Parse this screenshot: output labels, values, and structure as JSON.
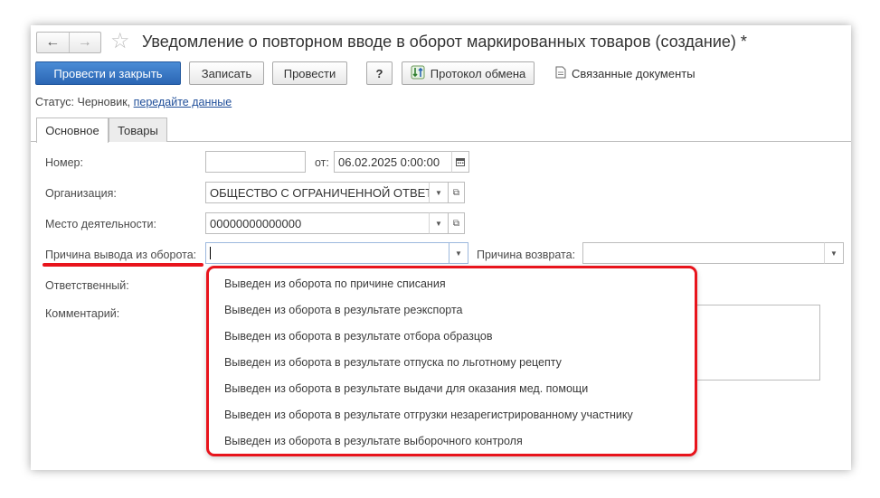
{
  "header": {
    "back_icon": "←",
    "forward_icon": "→",
    "star_icon": "☆",
    "title": "Уведомление о повторном вводе в оборот маркированных товаров (создание) *"
  },
  "toolbar": {
    "post_close_label": "Провести и закрыть",
    "save_label": "Записать",
    "post_label": "Провести",
    "help_label": "?",
    "protocol_label": "Протокол обмена",
    "related_docs_label": "Связанные документы"
  },
  "status": {
    "prefix": "Статус:",
    "value": "Черновик,",
    "link": "передайте данные"
  },
  "tabs": [
    {
      "label": "Основное",
      "active": true
    },
    {
      "label": "Товары",
      "active": false
    }
  ],
  "form": {
    "number_label": "Номер:",
    "number_value": "",
    "date_label": "от:",
    "date_value": "06.02.2025  0:00:00",
    "org_label": "Организация:",
    "org_value": "ОБЩЕСТВО С ОГРАНИЧЕННОЙ ОТВЕТСТВЕННОСТЬЮ",
    "place_label": "Место деятельности:",
    "place_value": "00000000000000",
    "reason_label": "Причина вывода из оборота:",
    "reason_value": "",
    "return_reason_label": "Причина возврата:",
    "return_reason_value": "",
    "responsible_label": "Ответственный:",
    "comment_label": "Комментарий:"
  },
  "dropdown": {
    "items": [
      "Выведен из оборота по причине списания",
      "Выведен из оборота в результате реэкспорта",
      "Выведен из оборота в результате отбора образцов",
      "Выведен из оборота в результате отпуска по льготному рецепту",
      "Выведен из оборота в результате выдачи для оказания мед. помощи",
      "Выведен из оборота в результате отгрузки незарегистрированному участнику",
      "Выведен из оборота в результате выборочного контроля"
    ]
  },
  "colors": {
    "accent_blue": "#2b66b4",
    "highlight_red": "#e8141c",
    "link": "#1f4e99"
  }
}
